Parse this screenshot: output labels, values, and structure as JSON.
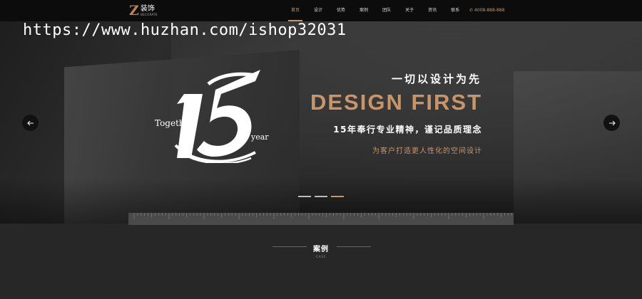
{
  "brand": {
    "logo_letter": "Z",
    "name": "装饰",
    "tagline": "DECORATE"
  },
  "nav": {
    "items": [
      "首页",
      "设计",
      "优势",
      "案例",
      "团队",
      "关于",
      "资讯",
      "联系"
    ],
    "active_index": 0,
    "phone": "✆ 4008-888-888"
  },
  "hero": {
    "logo_number": "15",
    "together": "Together",
    "year": "year",
    "slogan_cn": "一切以设计为先",
    "slogan_en": "DESIGN FIRST",
    "slogan_sub": "15年奉行专业精神，谨记品质理念",
    "slogan_small": "为客户打造更人性化的空间设计",
    "slide_count": 3,
    "active_slide": 2
  },
  "section": {
    "title": "案例",
    "subtitle": "CASE"
  },
  "watermark": "https://www.huzhan.com/ishop32031",
  "colors": {
    "accent": "#c49767",
    "nav_bg": "#0c0c0c",
    "section_bg": "#272727"
  },
  "icons": {
    "prev": "arrow-left-icon",
    "next": "arrow-right-icon"
  }
}
